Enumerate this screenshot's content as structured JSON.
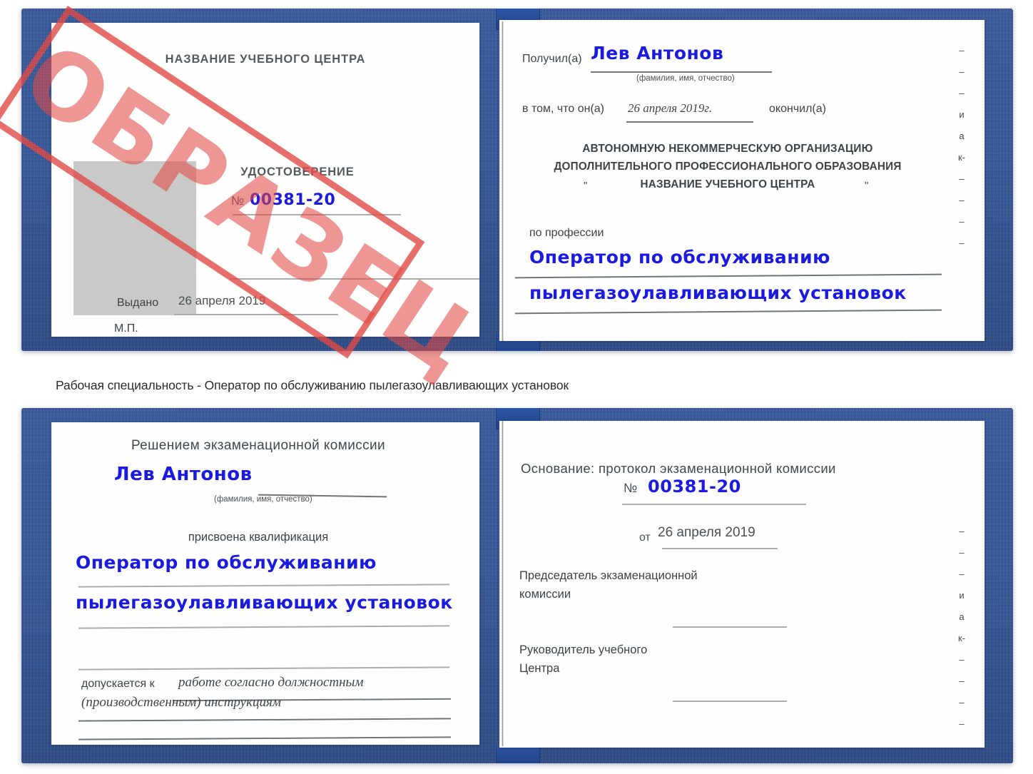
{
  "document": {
    "type": "certificate-spread",
    "watermark": "ОБРАЗЕЦ",
    "colors": {
      "cover_blue": "#27509c",
      "ink_blue": "#1a1ae1",
      "stamp_red": "#e04a46",
      "text_gray": "#3d4347",
      "rule_gray": "#a9adb1",
      "photo_gray": "#c9c9c9"
    }
  },
  "caption": "Рабочая специальность - Оператор по обслуживанию пылегазоулавливающих установок",
  "top_spread": {
    "left_page": {
      "center_name": "НАЗВАНИЕ УЧЕБНОГО ЦЕНТРА",
      "doc_title": "УДОСТОВЕРЕНИЕ",
      "number_label": "№",
      "number_value": "00381-20",
      "issued_label": "Выдано",
      "issued_date": "26 апреля 2019",
      "seal_label": "М.П.",
      "photo_placeholder": "photo-area"
    },
    "right_page": {
      "received_label": "Получил(а)",
      "received_name": "Лев Антонов",
      "name_hint": "(фамилия, имя, отчество)",
      "clause_prefix": "в том, что он(а)",
      "clause_date": "26 апреля 2019г.",
      "clause_suffix": "окончил(а)",
      "org_line1": "АВТОНОМНУЮ НЕКОММЕРЧЕСКУЮ ОРГАНИЗАЦИЮ",
      "org_line2": "ДОПОЛНИТЕЛЬНОГО ПРОФЕССИОНАЛЬНОГО ОБРАЗОВАНИЯ",
      "org_quote_open": "\"",
      "org_line3": "НАЗВАНИЕ УЧЕБНОГО ЦЕНТРА",
      "org_quote_close": "\"",
      "profession_label": "по профессии",
      "profession_line1": "Оператор по обслуживанию",
      "profession_line2": "пылегазоулавливающих установок",
      "edge_fragments": [
        "–",
        "–",
        "–",
        "и",
        "а",
        "к-",
        "–",
        "–",
        "–",
        "–"
      ]
    }
  },
  "bottom_spread": {
    "left_page": {
      "heading": "Решением экзаменационной комиссии",
      "name": "Лев Антонов",
      "name_hint": "(фамилия, имя, отчество)",
      "qualification_label": "присвоена квалификация",
      "qualification_line1": "Оператор по обслуживанию",
      "qualification_line2": "пылегазоулавливающих установок",
      "admitted_label": "допускается к",
      "admitted_line1": "работе согласно должностным",
      "admitted_line2": "(производственным) инструкциям"
    },
    "right_page": {
      "basis_label": "Основание: протокол экзаменационной комиссии",
      "number_label": "№",
      "number_value": "00381-20",
      "date_label": "от",
      "date_value": "26 апреля 2019",
      "chairman_line1": "Председатель экзаменационной",
      "chairman_line2": "комиссии",
      "director_line1": "Руководитель учебного",
      "director_line2": "Центра",
      "edge_fragments": [
        "–",
        "–",
        "–",
        "и",
        "а",
        "к-",
        "–",
        "–",
        "–",
        "–"
      ]
    }
  }
}
